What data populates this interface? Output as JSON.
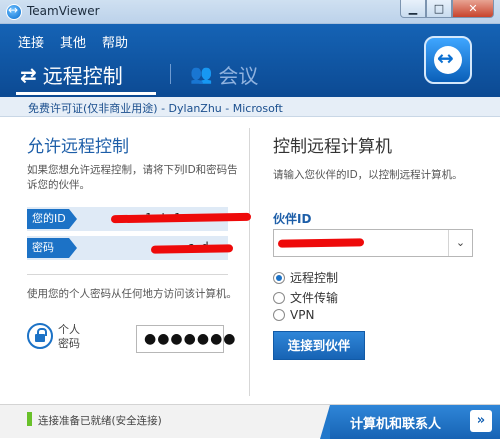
{
  "window": {
    "title": "TeamViewer"
  },
  "window_buttons": {
    "minimize": "▁",
    "maximize": "□",
    "close": "✕"
  },
  "menu": {
    "items": [
      "连接",
      "其他",
      "帮助"
    ]
  },
  "tabs": {
    "remote_control": "远程控制",
    "meeting": "会议"
  },
  "license": "免费许可证(仅非商业用途) - DylanZhu - Microsoft",
  "allow_panel": {
    "title": "允许远程控制",
    "description": "如果您想允许远程控制，请将下列ID和密码告诉您的伙伴。",
    "id_label": "您的ID",
    "id_value_fragment": "1 ' 1",
    "password_label": "密码",
    "password_value_fragment": "c   d",
    "personal_description": "使用您的个人密码从任何地方访问该计算机。",
    "personal_label": "个人\n密码",
    "personal_password_value": "●●●●●●●"
  },
  "control_panel": {
    "title": "控制远程计算机",
    "description": "请输入您伙伴的ID，以控制远程计算机。",
    "partner_id_label": "伙伴ID",
    "modes": [
      {
        "label": "远程控制",
        "selected": true
      },
      {
        "label": "文件传输",
        "selected": false
      },
      {
        "label": "VPN",
        "selected": false
      }
    ],
    "connect_button": "连接到伙伴"
  },
  "status": {
    "text": "连接准备已就绪(安全连接)",
    "color": "#69c12a"
  },
  "contacts_tab": {
    "label": "计算机和联系人",
    "chevron": "»"
  },
  "colors": {
    "brand_blue": "#1563b5",
    "accent": "#1c72c6",
    "redaction": "#ee0a0a"
  }
}
